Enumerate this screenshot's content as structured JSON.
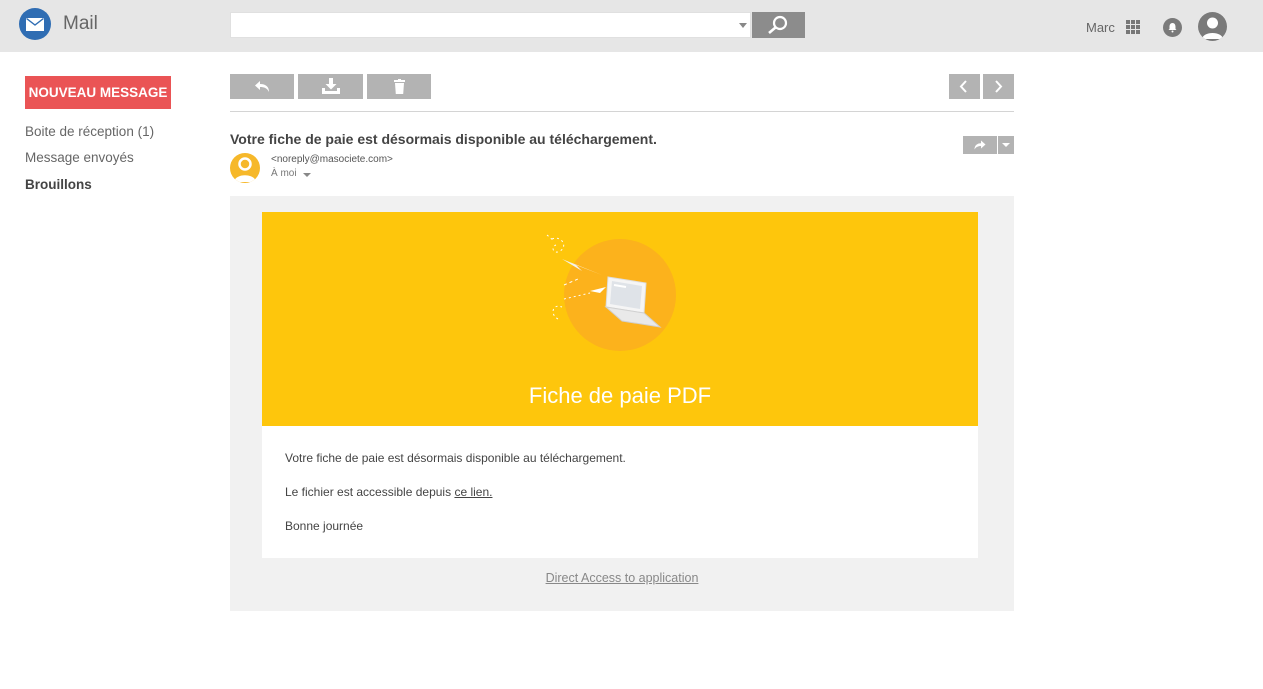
{
  "app": {
    "name": "Mail"
  },
  "search": {
    "placeholder": ""
  },
  "user": {
    "name": "Marc"
  },
  "sidebar": {
    "compose_label": "NOUVEAU MESSAGE",
    "items": [
      {
        "label": "Boite de réception (1)"
      },
      {
        "label": "Message envoyés"
      },
      {
        "label": "Brouillons"
      }
    ]
  },
  "message": {
    "subject": "Votre fiche de paie est désormais disponible au téléchargement.",
    "sender_email": "<noreply@masociete.com>",
    "recipient": "À moi"
  },
  "email": {
    "banner_title": "Fiche de paie PDF",
    "line1": "Votre fiche de paie est désormais disponible au téléchargement.",
    "line2_prefix": "Le fichier est accessible depuis ",
    "line2_link": "ce lien.",
    "line3": "Bonne journée",
    "direct_access": "Direct Access to application"
  },
  "colors": {
    "accent": "#ea5455",
    "banner": "#fec60c",
    "logo": "#2f6db3",
    "toolbar": "#b3b3b3"
  },
  "icons": {
    "logo": "envelope-icon",
    "search": "search-icon",
    "apps": "grid-icon",
    "notifications": "bell-icon",
    "profile": "user-avatar-icon",
    "reply": "reply-icon",
    "download": "download-icon",
    "delete": "trash-icon",
    "previous": "chevron-left-icon",
    "next": "chevron-right-icon",
    "forward": "forward-icon"
  }
}
